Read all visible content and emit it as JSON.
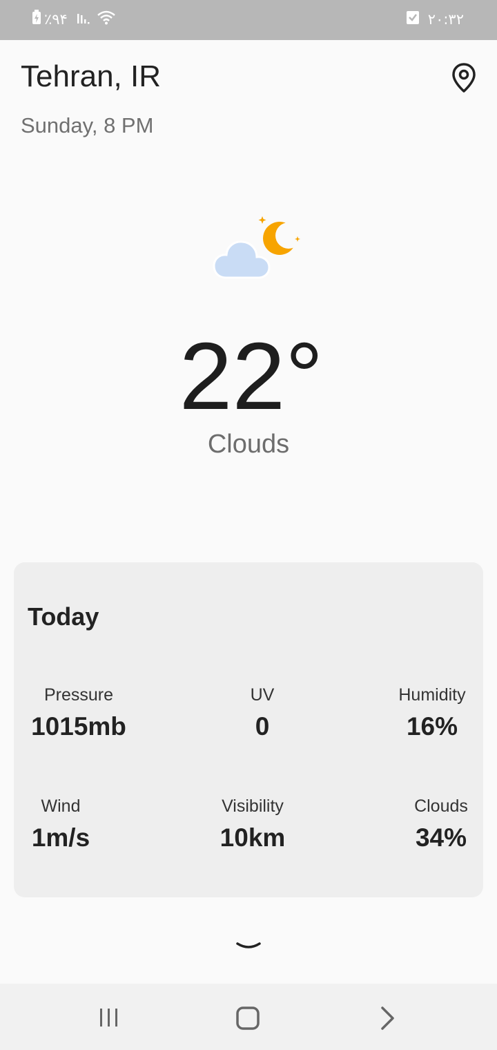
{
  "status_bar": {
    "battery_text": "٪۹۴",
    "time": "۲۰:۳۲"
  },
  "header": {
    "city": "Tehran, IR",
    "datetime": "Sunday, 8 PM"
  },
  "current": {
    "temperature": "22°",
    "condition": "Clouds",
    "icon": "cloud-moon-icon"
  },
  "today": {
    "title": "Today",
    "pressure_label": "Pressure",
    "pressure_value": "1015mb",
    "uv_label": "UV",
    "uv_value": "0",
    "humidity_label": "Humidity",
    "humidity_value": "16%",
    "wind_label": "Wind",
    "wind_value": "1m/s",
    "visibility_label": "Visibility",
    "visibility_value": "10km",
    "clouds_label": "Clouds",
    "clouds_value": "34%"
  },
  "colors": {
    "status_bar": "#b7b7b7",
    "background": "#fafafa",
    "card": "#eeeeee",
    "moon": "#f7a400",
    "cloud": "#c9dcf5"
  }
}
